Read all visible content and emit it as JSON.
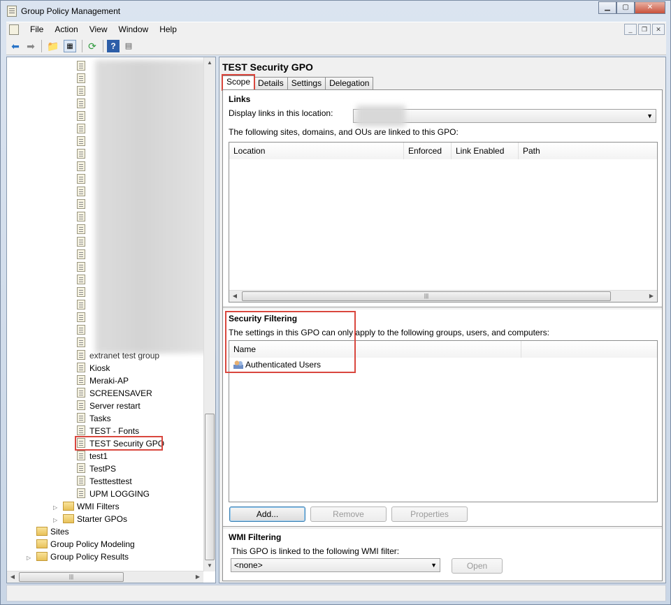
{
  "window": {
    "title": "Group Policy Management"
  },
  "menu": [
    "File",
    "Action",
    "View",
    "Window",
    "Help"
  ],
  "tree": {
    "gpo_items": [
      "Kiosk",
      "Meraki-AP",
      "SCREENSAVER",
      "Server restart",
      "Tasks",
      "TEST - Fonts",
      "TEST Security GPO",
      "test1",
      "TestPS",
      "Testtesttest",
      "UPM LOGGING"
    ],
    "partially_hidden_item": "extranet test group",
    "wmi_filters": "WMI Filters",
    "starter_gpos": "Starter GPOs",
    "sites": "Sites",
    "gp_modeling": "Group Policy Modeling",
    "gp_results": "Group Policy Results",
    "selected": "TEST Security GPO"
  },
  "details": {
    "title": "TEST Security GPO",
    "tabs": [
      "Scope",
      "Details",
      "Settings",
      "Delegation"
    ],
    "active_tab": "Scope",
    "links": {
      "heading": "Links",
      "display_label": "Display links in this location:",
      "linked_label": "The following sites, domains, and OUs are linked to this GPO:",
      "columns": [
        "Location",
        "Enforced",
        "Link Enabled",
        "Path"
      ]
    },
    "security_filtering": {
      "heading": "Security Filtering",
      "description": "The settings in this GPO can only apply to the following groups, users, and computers:",
      "column": "Name",
      "entries": [
        "Authenticated Users"
      ],
      "buttons": {
        "add": "Add...",
        "remove": "Remove",
        "properties": "Properties"
      }
    },
    "wmi_filtering": {
      "heading": "WMI Filtering",
      "description": "This GPO is linked to the following WMI filter:",
      "selected_filter": "<none>",
      "open_button": "Open"
    }
  },
  "colors": {
    "highlight": "#d9473e",
    "window_frame": "#c9d6e6"
  }
}
